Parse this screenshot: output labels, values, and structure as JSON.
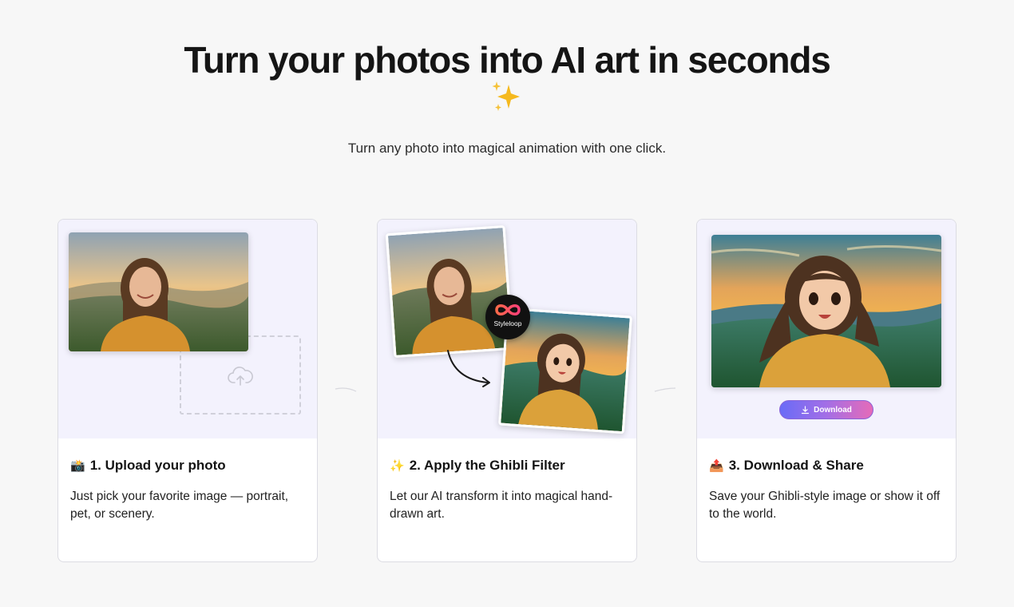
{
  "hero": {
    "title": "Turn your photos into AI art in seconds",
    "subtitle": "Turn any photo into magical animation with one click."
  },
  "steps": [
    {
      "emoji": "📸",
      "title": "1. Upload your photo",
      "description": "Just pick your favorite image — portrait, pet, or scenery."
    },
    {
      "emoji": "✨",
      "title": "2. Apply the Ghibli Filter",
      "description": "Let our AI transform it into magical hand-drawn art.",
      "brand_badge": "Styleloop"
    },
    {
      "emoji": "📤",
      "title": "3. Download & Share",
      "description": "Save your Ghibli-style image or show it off to the world.",
      "button_label": "Download"
    }
  ],
  "icons": {
    "hero": "sparkles-icon",
    "upload": "cloud-upload-icon",
    "download": "download-icon"
  },
  "colors": {
    "visual_bg": "#f3f2fd",
    "button_gradient_start": "#6a6cf7",
    "button_gradient_end": "#e56bb8"
  }
}
